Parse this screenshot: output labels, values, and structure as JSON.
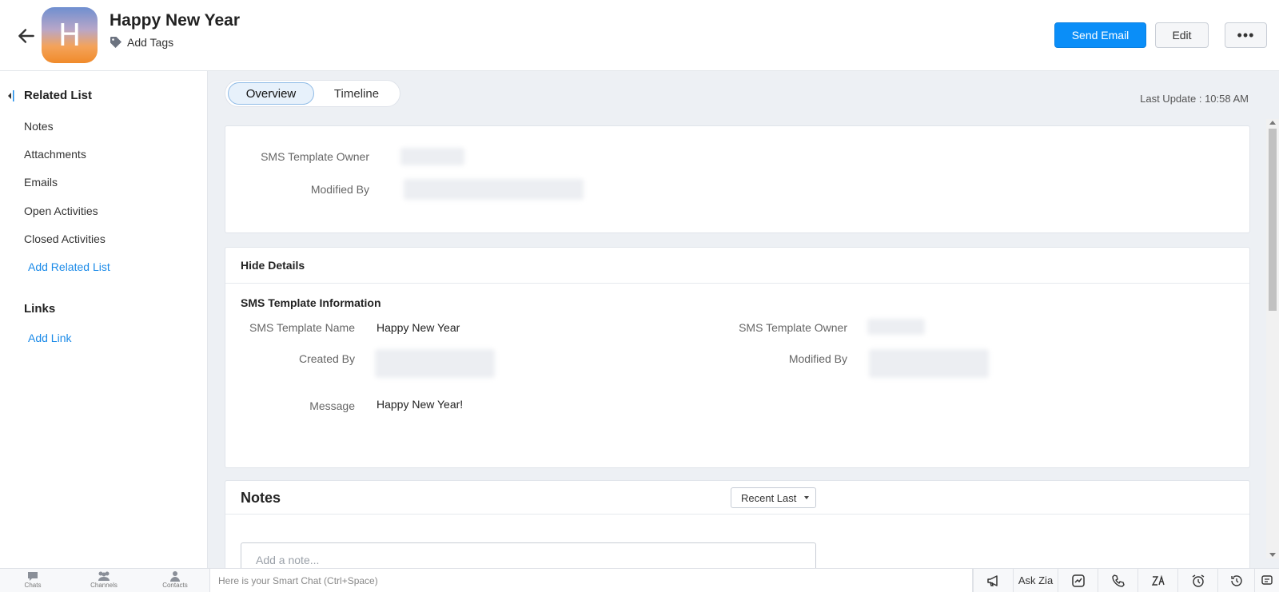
{
  "header": {
    "avatar_letter": "H",
    "title": "Happy New Year",
    "add_tags_label": "Add Tags",
    "send_email_label": "Send Email",
    "edit_label": "Edit",
    "more_label": "•••"
  },
  "sidebar": {
    "related_list_heading": "Related List",
    "items": [
      {
        "label": "Notes"
      },
      {
        "label": "Attachments"
      },
      {
        "label": "Emails"
      },
      {
        "label": "Open Activities"
      },
      {
        "label": "Closed Activities"
      }
    ],
    "add_related_list_label": "Add Related List",
    "links_heading": "Links",
    "add_link_label": "Add Link"
  },
  "main": {
    "tabs": [
      {
        "label": "Overview",
        "active": true
      },
      {
        "label": "Timeline",
        "active": false
      }
    ],
    "last_update": "Last Update : 10:58 AM",
    "summary": {
      "owner_label": "SMS Template Owner",
      "modified_by_label": "Modified By"
    },
    "details": {
      "hide_details_label": "Hide Details",
      "section_title": "SMS Template Information",
      "name_label": "SMS Template Name",
      "name_value": "Happy New Year",
      "owner_label": "SMS Template Owner",
      "created_by_label": "Created By",
      "modified_by_label": "Modified By",
      "message_label": "Message",
      "message_value": "Happy New Year!"
    },
    "notes": {
      "title": "Notes",
      "sort_value": "Recent Last",
      "input_placeholder": "Add a note..."
    }
  },
  "bottombar": {
    "chats_label": "Chats",
    "channels_label": "Channels",
    "contacts_label": "Contacts",
    "smart_chat_placeholder": "Here is your Smart Chat (Ctrl+Space)",
    "ask_zia_label": "Ask Zia"
  },
  "colors": {
    "primary": "#0a8ef8",
    "link": "#1a8ae8",
    "background": "#edf0f4"
  }
}
